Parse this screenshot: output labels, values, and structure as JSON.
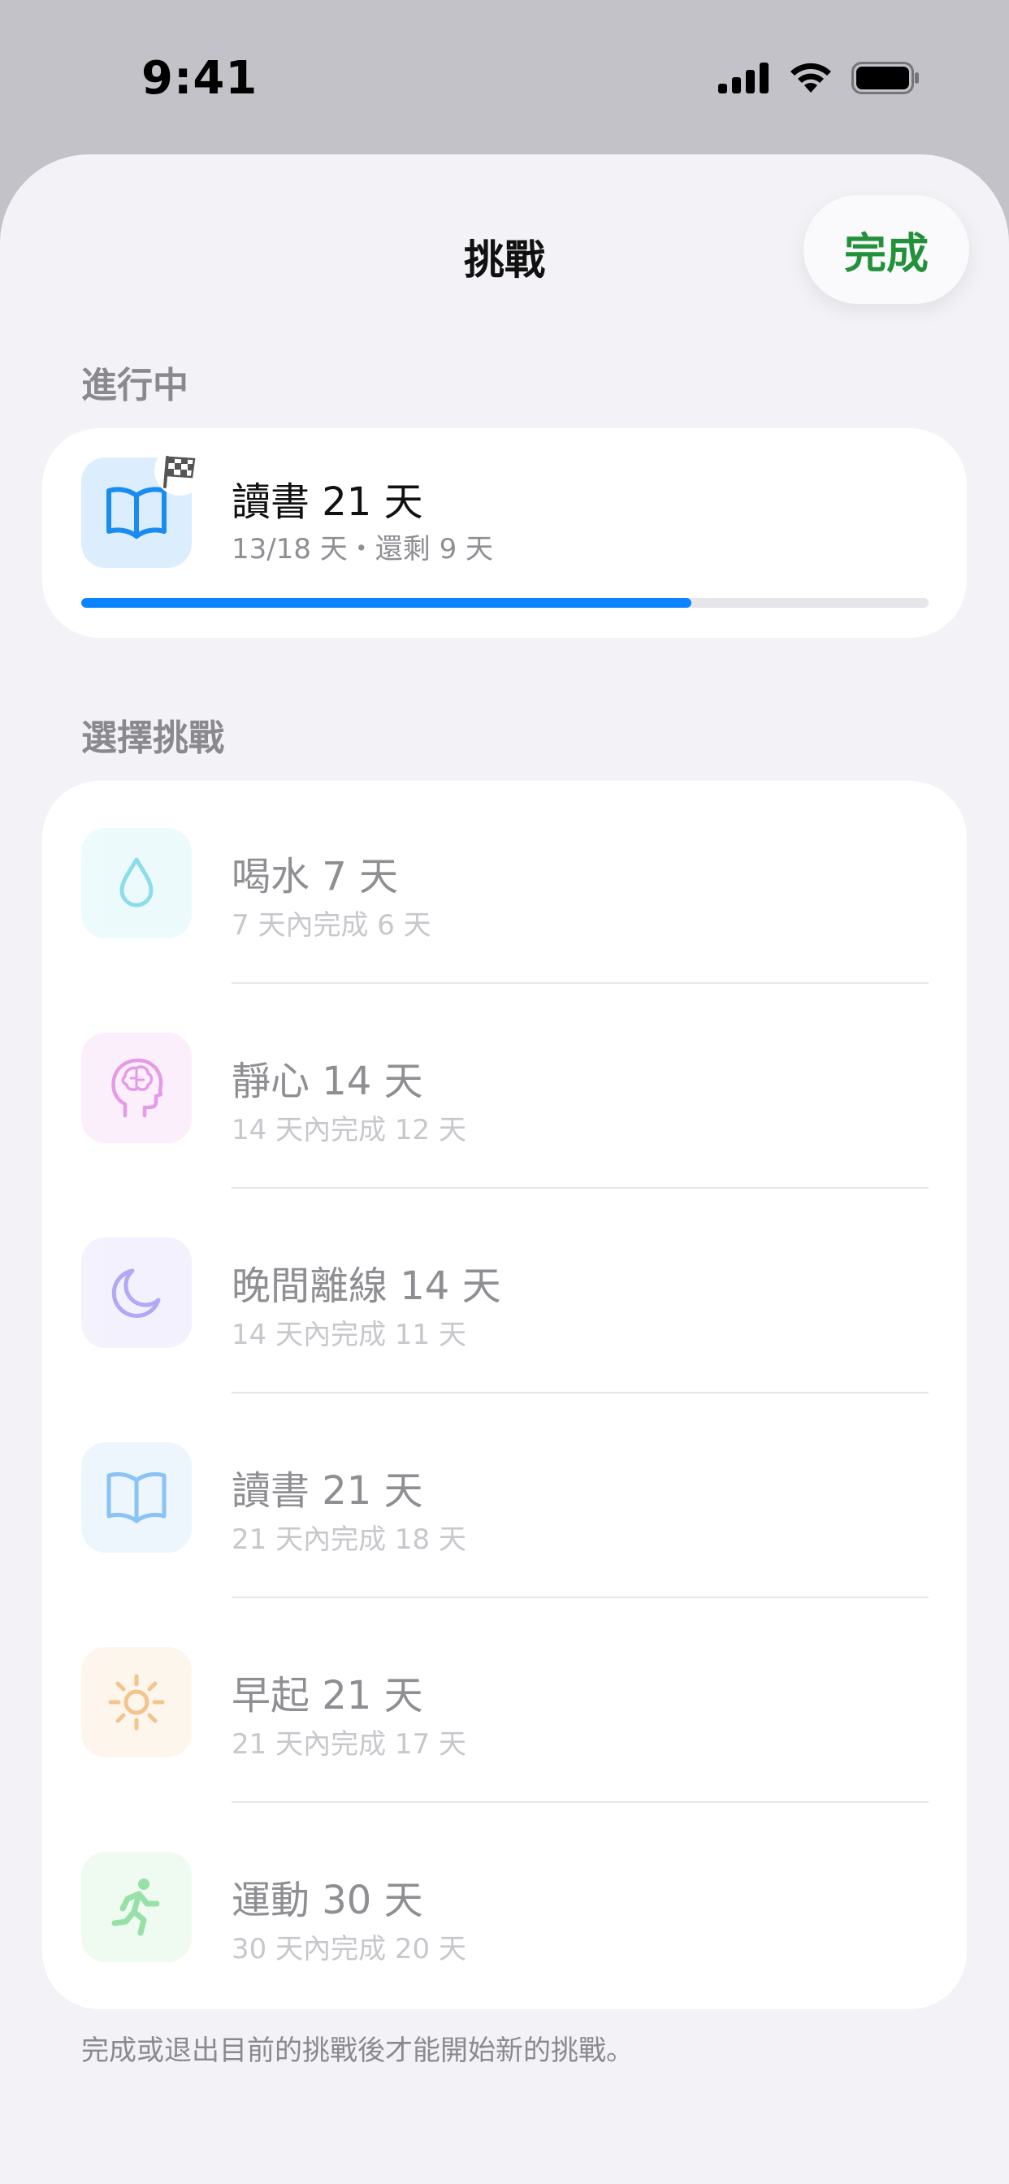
{
  "status_bar": {
    "time": "9:41"
  },
  "header": {
    "title": "挑戰",
    "done_label": "完成"
  },
  "active_section": {
    "header": "進行中",
    "challenge": {
      "title": "讀書 21 天",
      "subtitle": "13/18 天・還剩 9 天",
      "progress": 0.72,
      "icon": "book-icon",
      "badge_icon": "checkered-flag-icon",
      "accent": "#0a84ff"
    }
  },
  "choose_section": {
    "header": "選擇挑戰",
    "items": [
      {
        "title": "喝水 7 天",
        "subtitle": "7 天內完成 6 天",
        "icon": "water-drop-icon",
        "color": "#40c8e0",
        "bg": "#e4f8fb"
      },
      {
        "title": "靜心 14 天",
        "subtitle": "14 天內完成 12 天",
        "icon": "brain-head-icon",
        "color": "#d65bd9",
        "bg": "#f7e6f8"
      },
      {
        "title": "晚間離線 14 天",
        "subtitle": "14 天內完成 11 天",
        "icon": "moon-icon",
        "color": "#7d6cf0",
        "bg": "#ecebfd"
      },
      {
        "title": "讀書 21 天",
        "subtitle": "21 天內完成 18 天",
        "icon": "book-icon",
        "color": "#3aa0f0",
        "bg": "#e4f1fd"
      },
      {
        "title": "早起 21 天",
        "subtitle": "21 天內完成 17 天",
        "icon": "sun-icon",
        "color": "#f0a040",
        "bg": "#fdf1e4"
      },
      {
        "title": "運動 30 天",
        "subtitle": "30 天內完成 20 天",
        "icon": "running-figure-icon",
        "color": "#4ccf6c",
        "bg": "#e6f8ea"
      }
    ]
  },
  "footer_note": "完成或退出目前的挑戰後才能開始新的挑戰。"
}
